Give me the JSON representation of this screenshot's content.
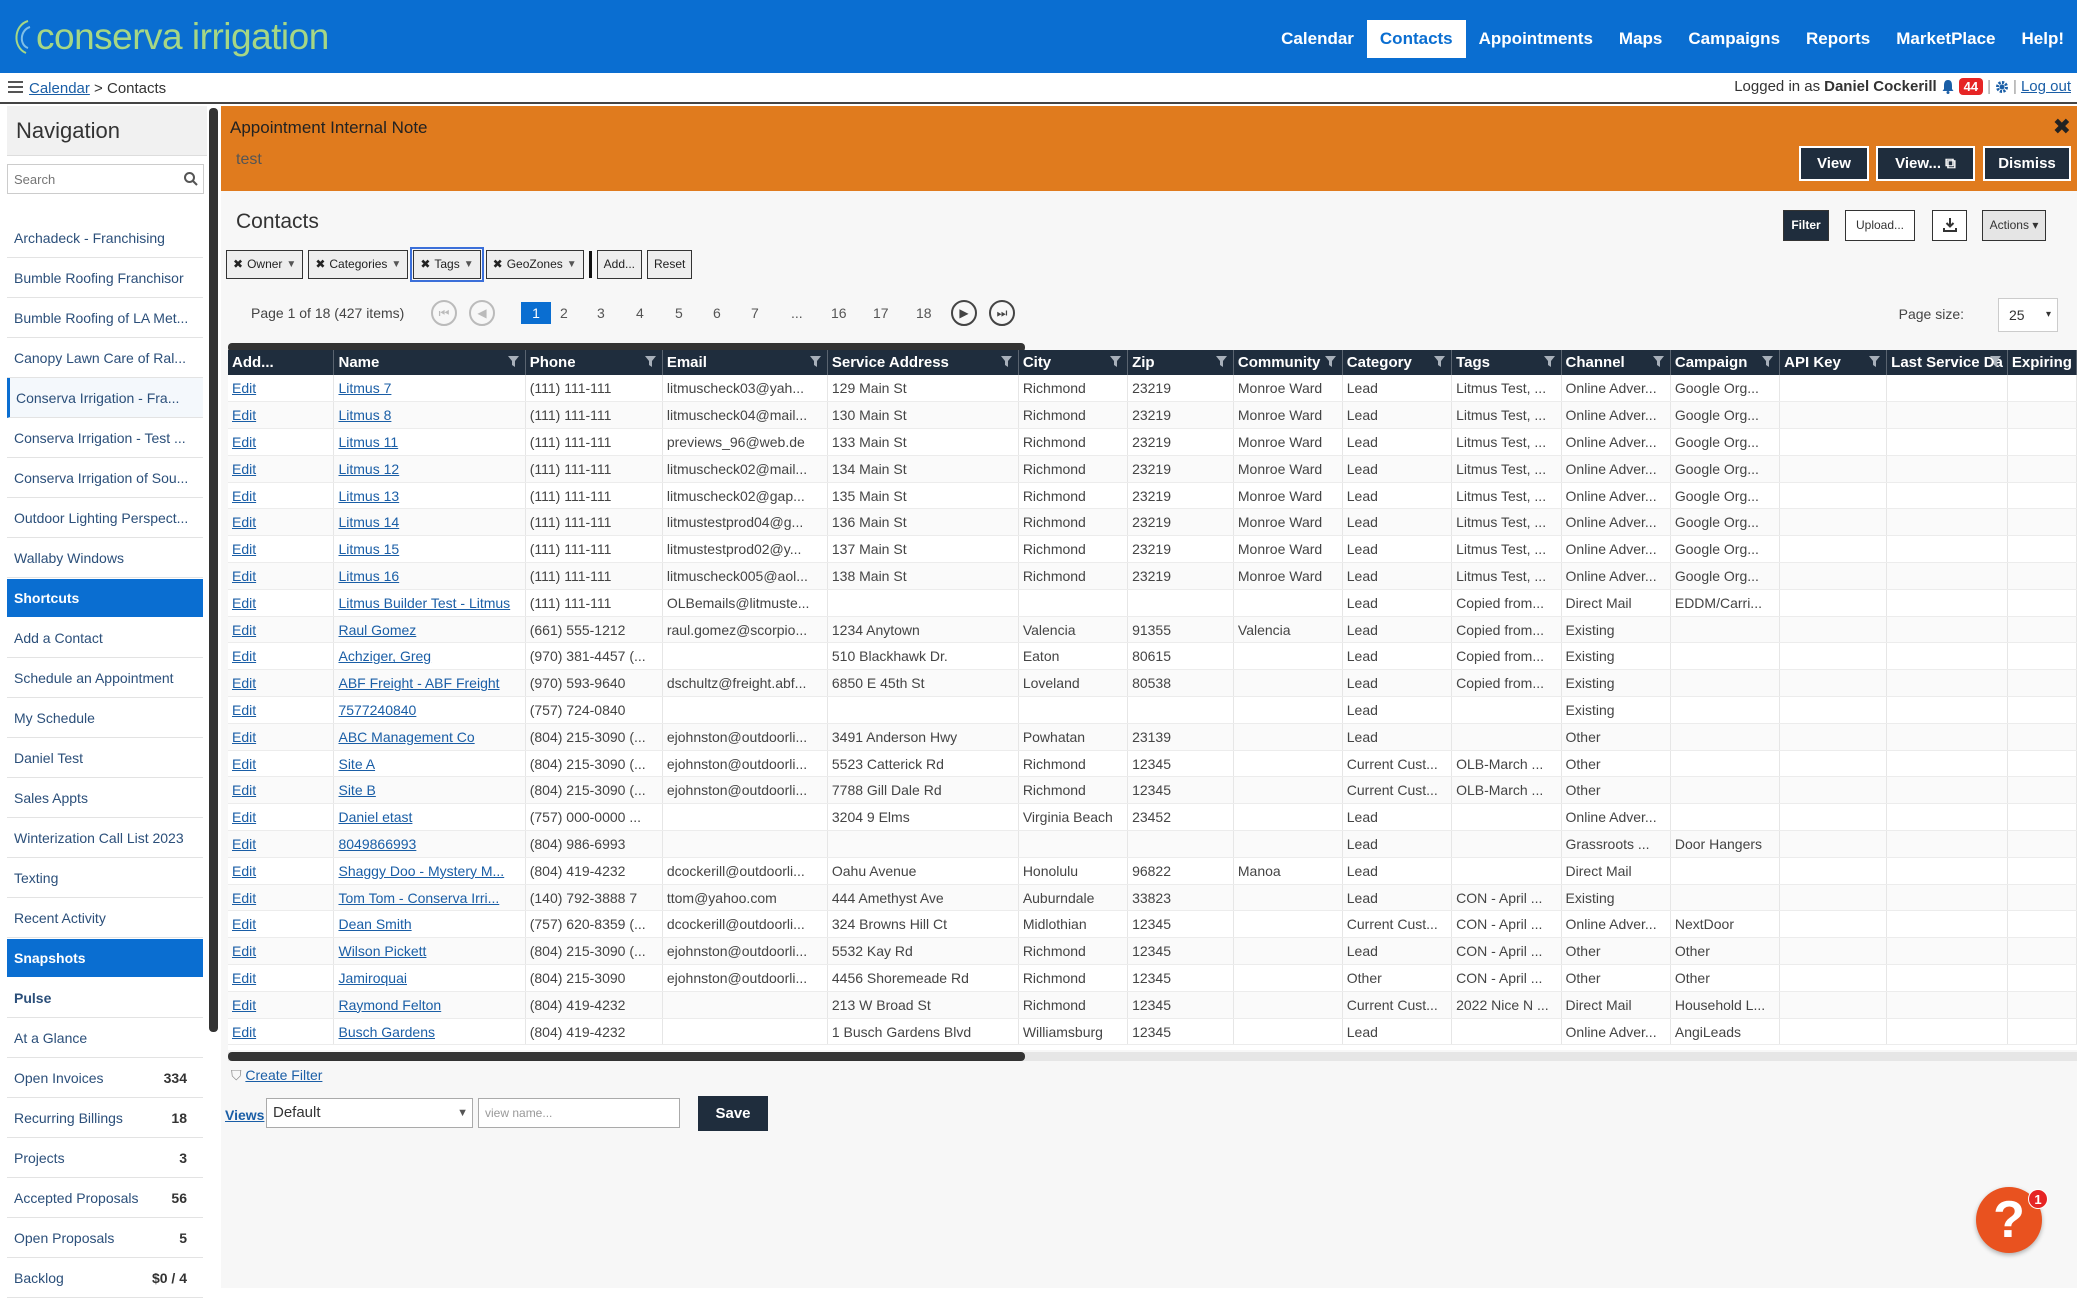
{
  "app": {
    "logo_text": "conserva irrigation",
    "brand_color": "#0a6ed1",
    "accent_color": "#e07b1e"
  },
  "topnav": [
    "Calendar",
    "Contacts",
    "Appointments",
    "Maps",
    "Campaigns",
    "Reports",
    "MarketPlace",
    "Help!"
  ],
  "topnav_active": "Contacts",
  "breadcrumb": {
    "link": "Calendar",
    "sep": ">",
    "current": "Contacts"
  },
  "user": {
    "prefix": "Logged in as",
    "name": "Daniel Cockerill",
    "notifications": "44",
    "logout": "Log out"
  },
  "sidebar": {
    "title": "Navigation",
    "search_placeholder": "Search",
    "accounts": [
      "Archadeck - Franchising",
      "Bumble Roofing Franchisor",
      "Bumble Roofing of LA Met...",
      "Canopy Lawn Care of Ral...",
      "Conserva Irrigation - Fra...",
      "Conserva Irrigation - Test ...",
      "Conserva Irrigation of Sou...",
      "Outdoor Lighting Perspect...",
      "Wallaby Windows"
    ],
    "shortcuts_head": "Shortcuts",
    "shortcuts": [
      "Add a Contact",
      "Schedule an Appointment",
      "My Schedule",
      "Daniel Test",
      "Sales Appts",
      "Winterization Call List 2023",
      "Texting",
      "Recent Activity"
    ],
    "snapshots_head": "Snapshots",
    "snapshots": [
      {
        "label": "Pulse",
        "count": ""
      },
      {
        "label": "At a Glance",
        "count": ""
      },
      {
        "label": "Open Invoices",
        "count": "334"
      },
      {
        "label": "Recurring Billings",
        "count": "18"
      },
      {
        "label": "Projects",
        "count": "3"
      },
      {
        "label": "Accepted Proposals",
        "count": "56"
      },
      {
        "label": "Open Proposals",
        "count": "5"
      },
      {
        "label": "Backlog",
        "count": "$0 / 4"
      }
    ]
  },
  "alert": {
    "title": "Appointment Internal Note",
    "body": "test",
    "buttons": {
      "view": "View",
      "view_new": "View...",
      "dismiss": "Dismiss"
    }
  },
  "contacts": {
    "title": "Contacts",
    "buttons": {
      "filter": "Filter",
      "upload": "Upload...",
      "actions": "Actions"
    }
  },
  "filters": {
    "chips": [
      "Owner",
      "Categories",
      "Tags",
      "GeoZones"
    ],
    "add": "Add...",
    "reset": "Reset"
  },
  "pager": {
    "info": "Page 1 of 18 (427 items)",
    "pages": [
      "1",
      "2",
      "3",
      "4",
      "5",
      "6",
      "7",
      "...",
      "16",
      "17",
      "18"
    ],
    "current": "1",
    "size_label": "Page size:",
    "size": "25"
  },
  "table": {
    "columns": [
      "Add...",
      "Name",
      "Phone",
      "Email",
      "Service Address",
      "City",
      "Zip",
      "Community",
      "Category",
      "Tags",
      "Channel",
      "Campaign",
      "API Key",
      "Last Service Da",
      "Expiring"
    ],
    "rows": [
      [
        "Edit",
        "Litmus 7",
        "(111) 111-111",
        "litmuscheck03@yah...",
        "129 Main St",
        "Richmond",
        "23219",
        "Monroe Ward",
        "Lead",
        "Litmus Test, ...",
        "Online Adver...",
        "Google Org...",
        "",
        "",
        ""
      ],
      [
        "Edit",
        "Litmus 8",
        "(111) 111-111",
        "litmuscheck04@mail...",
        "130 Main St",
        "Richmond",
        "23219",
        "Monroe Ward",
        "Lead",
        "Litmus Test, ...",
        "Online Adver...",
        "Google Org...",
        "",
        "",
        ""
      ],
      [
        "Edit",
        "Litmus 11",
        "(111) 111-111",
        "previews_96@web.de",
        "133 Main St",
        "Richmond",
        "23219",
        "Monroe Ward",
        "Lead",
        "Litmus Test, ...",
        "Online Adver...",
        "Google Org...",
        "",
        "",
        ""
      ],
      [
        "Edit",
        "Litmus 12",
        "(111) 111-111",
        "litmuscheck02@mail...",
        "134 Main St",
        "Richmond",
        "23219",
        "Monroe Ward",
        "Lead",
        "Litmus Test, ...",
        "Online Adver...",
        "Google Org...",
        "",
        "",
        ""
      ],
      [
        "Edit",
        "Litmus 13",
        "(111) 111-111",
        "litmuscheck02@gap...",
        "135 Main St",
        "Richmond",
        "23219",
        "Monroe Ward",
        "Lead",
        "Litmus Test, ...",
        "Online Adver...",
        "Google Org...",
        "",
        "",
        ""
      ],
      [
        "Edit",
        "Litmus 14",
        "(111) 111-111",
        "litmustestprod04@g...",
        "136 Main St",
        "Richmond",
        "23219",
        "Monroe Ward",
        "Lead",
        "Litmus Test, ...",
        "Online Adver...",
        "Google Org...",
        "",
        "",
        ""
      ],
      [
        "Edit",
        "Litmus 15",
        "(111) 111-111",
        "litmustestprod02@y...",
        "137 Main St",
        "Richmond",
        "23219",
        "Monroe Ward",
        "Lead",
        "Litmus Test, ...",
        "Online Adver...",
        "Google Org...",
        "",
        "",
        ""
      ],
      [
        "Edit",
        "Litmus 16",
        "(111) 111-111",
        "litmuscheck005@aol...",
        "138 Main St",
        "Richmond",
        "23219",
        "Monroe Ward",
        "Lead",
        "Litmus Test, ...",
        "Online Adver...",
        "Google Org...",
        "",
        "",
        ""
      ],
      [
        "Edit",
        "Litmus Builder Test - Litmus",
        "(111) 111-111",
        "OLBemails@litmuste...",
        "",
        "",
        "",
        "",
        "Lead",
        "Copied from...",
        "Direct Mail",
        "EDDM/Carri...",
        "",
        "",
        ""
      ],
      [
        "Edit",
        "Raul Gomez",
        "(661) 555-1212",
        "raul.gomez@scorpio...",
        "1234 Anytown",
        "Valencia",
        "91355",
        "Valencia",
        "Lead",
        "Copied from...",
        "Existing",
        "",
        "",
        "",
        ""
      ],
      [
        "Edit",
        "Achziger, Greg",
        "(970) 381-4457 (...",
        "",
        "510 Blackhawk Dr.",
        "Eaton",
        "80615",
        "",
        "Lead",
        "Copied from...",
        "Existing",
        "",
        "",
        "",
        ""
      ],
      [
        "Edit",
        "ABF Freight - ABF Freight",
        "(970) 593-9640",
        "dschultz@freight.abf...",
        "6850 E 45th St",
        "Loveland",
        "80538",
        "",
        "Lead",
        "Copied from...",
        "Existing",
        "",
        "",
        "",
        ""
      ],
      [
        "Edit",
        "7577240840",
        "(757) 724-0840",
        "",
        "",
        "",
        "",
        "",
        "Lead",
        "",
        "Existing",
        "",
        "",
        "",
        ""
      ],
      [
        "Edit",
        "ABC Management Co",
        "(804) 215-3090 (...",
        "ejohnston@outdoorli...",
        "3491 Anderson Hwy",
        "Powhatan",
        "23139",
        "",
        "Lead",
        "",
        "Other",
        "",
        "",
        "",
        ""
      ],
      [
        "Edit",
        "Site A",
        "(804) 215-3090 (...",
        "ejohnston@outdoorli...",
        "5523 Catterick Rd",
        "Richmond",
        "12345",
        "",
        "Current Cust...",
        "OLB-March ...",
        "Other",
        "",
        "",
        "",
        ""
      ],
      [
        "Edit",
        "Site B",
        "(804) 215-3090 (...",
        "ejohnston@outdoorli...",
        "7788 Gill Dale Rd",
        "Richmond",
        "12345",
        "",
        "Current Cust...",
        "OLB-March ...",
        "Other",
        "",
        "",
        "",
        ""
      ],
      [
        "Edit",
        "Daniel etast",
        "(757) 000-0000 ...",
        "",
        "3204 9 Elms",
        "Virginia Beach",
        "23452",
        "",
        "Lead",
        "",
        "Online Adver...",
        "",
        "",
        "",
        ""
      ],
      [
        "Edit",
        "8049866993",
        "(804) 986-6993",
        "",
        "",
        "",
        "",
        "",
        "Lead",
        "",
        "Grassroots ...",
        "Door Hangers",
        "",
        "",
        ""
      ],
      [
        "Edit",
        "Shaggy Doo - Mystery M...",
        "(804) 419-4232",
        "dcockerill@outdoorli...",
        "Oahu Avenue",
        "Honolulu",
        "96822",
        "Manoa",
        "Lead",
        "",
        "Direct Mail",
        "",
        "",
        "",
        ""
      ],
      [
        "Edit",
        "Tom Tom - Conserva Irri...",
        "(140) 792-3888 7",
        "ttom@yahoo.com",
        "444 Amethyst Ave",
        "Auburndale",
        "33823",
        "",
        "Lead",
        "CON - April ...",
        "Existing",
        "",
        "",
        "",
        ""
      ],
      [
        "Edit",
        "Dean Smith",
        "(757) 620-8359 (...",
        "dcockerill@outdoorli...",
        "324 Browns Hill Ct",
        "Midlothian",
        "12345",
        "",
        "Current Cust...",
        "CON - April ...",
        "Online Adver...",
        "NextDoor",
        "",
        "",
        ""
      ],
      [
        "Edit",
        "Wilson Pickett",
        "(804) 215-3090 (...",
        "ejohnston@outdoorli...",
        "5532 Kay Rd",
        "Richmond",
        "12345",
        "",
        "Lead",
        "CON - April ...",
        "Other",
        "Other",
        "",
        "",
        ""
      ],
      [
        "Edit",
        "Jamiroquai",
        "(804) 215-3090",
        "ejohnston@outdoorli...",
        "4456 Shoremeade Rd",
        "Richmond",
        "12345",
        "",
        "Other",
        "CON - April ...",
        "Other",
        "Other",
        "",
        "",
        ""
      ],
      [
        "Edit",
        "Raymond Felton",
        "(804) 419-4232",
        "",
        "213 W Broad St",
        "Richmond",
        "12345",
        "",
        "Current Cust...",
        "2022 Nice N ...",
        "Direct Mail",
        "Household L...",
        "",
        "",
        ""
      ],
      [
        "Edit",
        "Busch Gardens",
        "(804) 419-4232",
        "",
        "1 Busch Gardens Blvd",
        "Williamsburg",
        "12345",
        "",
        "Lead",
        "",
        "Online Adver...",
        "AngiLeads",
        "",
        "",
        ""
      ]
    ]
  },
  "below": {
    "create_filter": "Create Filter",
    "views_label": "Views",
    "views_value": "Default",
    "view_name_placeholder": "view name...",
    "save": "Save"
  },
  "help": {
    "label": "?",
    "badge": "1"
  }
}
